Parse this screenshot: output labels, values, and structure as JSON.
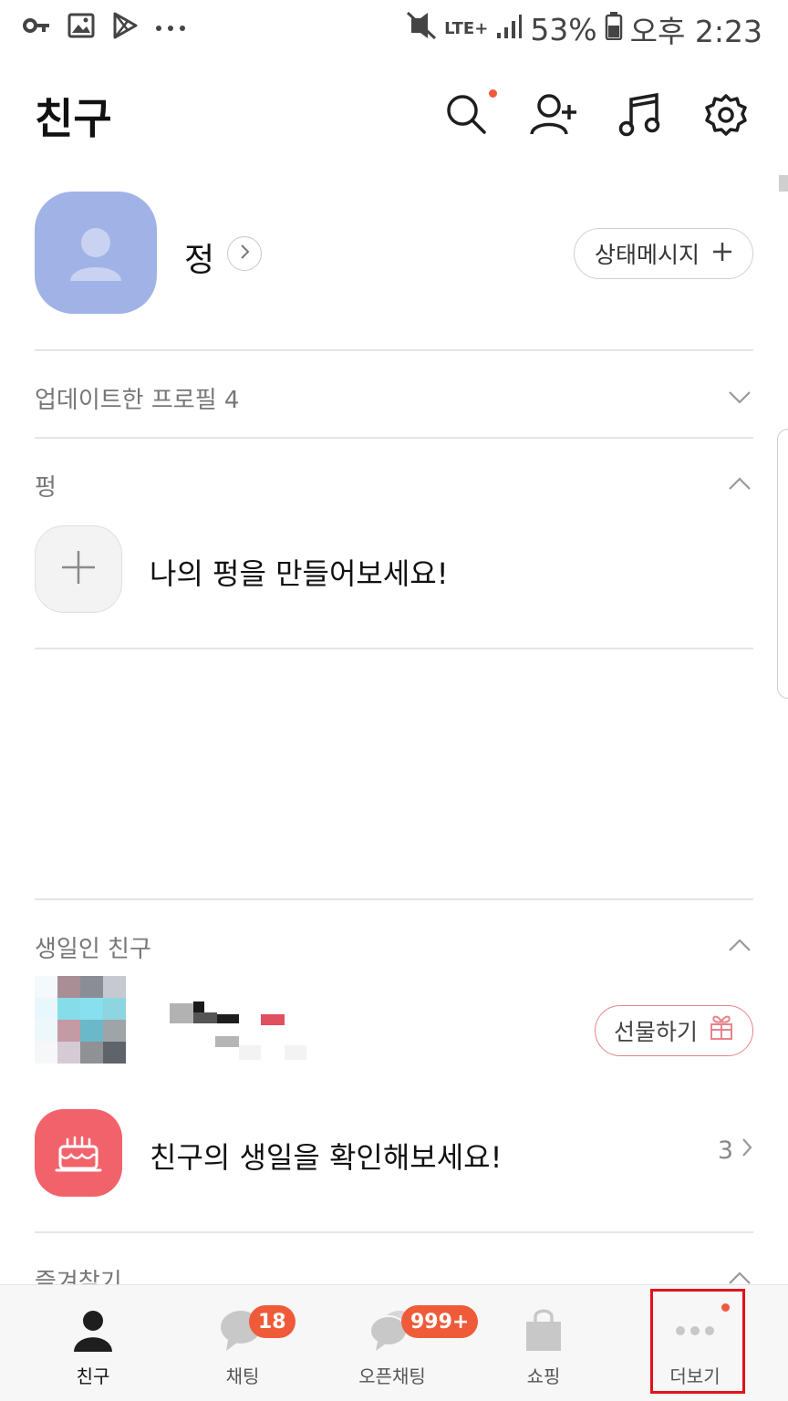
{
  "status_bar": {
    "battery": "53%",
    "network": "LTE+",
    "time": "오후 2:23",
    "left_icons": [
      "key-icon",
      "image-icon",
      "play-store-icon",
      "more-icon"
    ]
  },
  "header": {
    "title": "친구",
    "icons": [
      "search-icon",
      "add-friend-icon",
      "music-icon",
      "settings-icon"
    ]
  },
  "profile": {
    "name": "정",
    "status_message_button": "상태메시지"
  },
  "updated_profiles": {
    "label": "업데이트한 프로필 4"
  },
  "pung": {
    "label": "펑",
    "create_text": "나의 펑을 만들어보세요!"
  },
  "birthday": {
    "label": "생일인 친구",
    "gift_button": "선물하기",
    "check_text": "친구의 생일을 확인해보세요!",
    "count": "3"
  },
  "favorites": {
    "label": "즐겨찾기"
  },
  "tabbar": {
    "tabs": [
      {
        "label": "친구",
        "badge": ""
      },
      {
        "label": "채팅",
        "badge": "18"
      },
      {
        "label": "오픈채팅",
        "badge": "999+"
      },
      {
        "label": "쇼핑",
        "badge": ""
      },
      {
        "label": "더보기",
        "badge": ""
      }
    ]
  },
  "colors": {
    "accent_badge": "#ef5b39",
    "avatar_bg": "#a1b3e6",
    "cake_bg": "#f2626b",
    "highlight": "#e0121b"
  }
}
